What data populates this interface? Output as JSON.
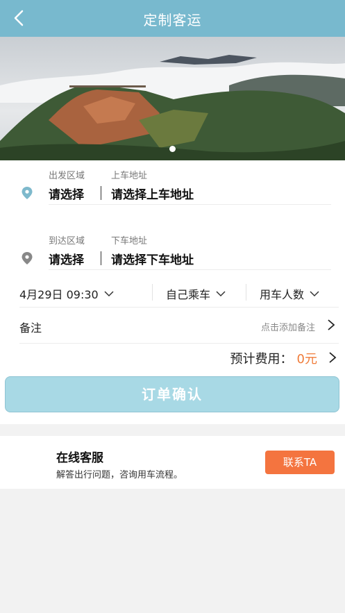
{
  "header": {
    "title": "定制客运",
    "back_icon": "back-arrow-icon"
  },
  "banner": {
    "image": "mountain-sea-of-clouds",
    "active_dot": 1,
    "dot_count": 1
  },
  "departure": {
    "area_label": "出发区域",
    "address_label": "上车地址",
    "area_value": "请选择",
    "address_value": "请选择上车地址",
    "icon": "location-pin-icon",
    "icon_color": "#7eb9cc"
  },
  "arrival": {
    "area_label": "到达区域",
    "address_label": "下车地址",
    "area_value": "请选择",
    "address_value": "请选择下车地址",
    "icon": "location-pin-icon",
    "icon_color": "#888888"
  },
  "options": {
    "datetime": "4月29日 09:30",
    "ride_type": "自己乘车",
    "passengers": "用车人数"
  },
  "remark": {
    "label": "备注",
    "hint": "点击添加备注"
  },
  "fee": {
    "label": "预计费用：",
    "amount": "0元",
    "amount_color": "#f07c3a"
  },
  "confirm_button": {
    "label": "订单确认",
    "color": "#a8d9e5"
  },
  "service": {
    "title": "在线客服",
    "desc": "解答出行问题，咨询用车流程。",
    "button_label": "联系TA",
    "button_color": "#f4743f"
  },
  "colors": {
    "header": "#78b9ce",
    "background": "#f2f2f2"
  }
}
